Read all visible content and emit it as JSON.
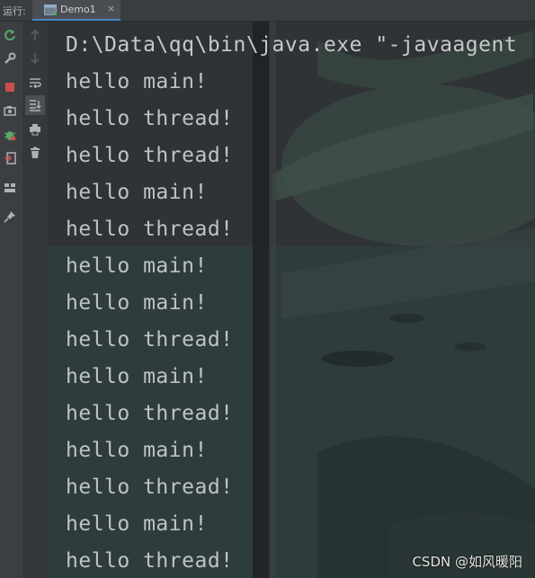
{
  "run_label": "运行:",
  "tab": {
    "title": "Demo1",
    "close": "×"
  },
  "console": {
    "command_line": "D:\\Data\\qq\\bin\\java.exe \"-javaagent",
    "lines": [
      "hello main!",
      "hello thread!",
      "hello thread!",
      "hello main!",
      "hello thread!",
      "hello main!",
      "hello main!",
      "hello thread!",
      "hello main!",
      "hello thread!",
      "hello main!",
      "hello thread!",
      "hello main!",
      "hello thread!"
    ]
  },
  "watermark": "CSDN @如风暖阳",
  "toolbar_left": [
    "rerun-icon",
    "settings-wrench-icon",
    "stop-icon",
    "camera-icon",
    "debug-bug-icon",
    "exit-icon",
    "layout-icon",
    "pin-icon"
  ],
  "toolbar_right": [
    "up-arrow-icon",
    "down-arrow-icon",
    "soft-wrap-icon",
    "scroll-to-end-icon",
    "print-icon",
    "trash-icon"
  ],
  "colors": {
    "accent": "#4a88c7",
    "stop": "#c94f4f",
    "rerun": "#59a869",
    "text": "#bfc3c6"
  }
}
